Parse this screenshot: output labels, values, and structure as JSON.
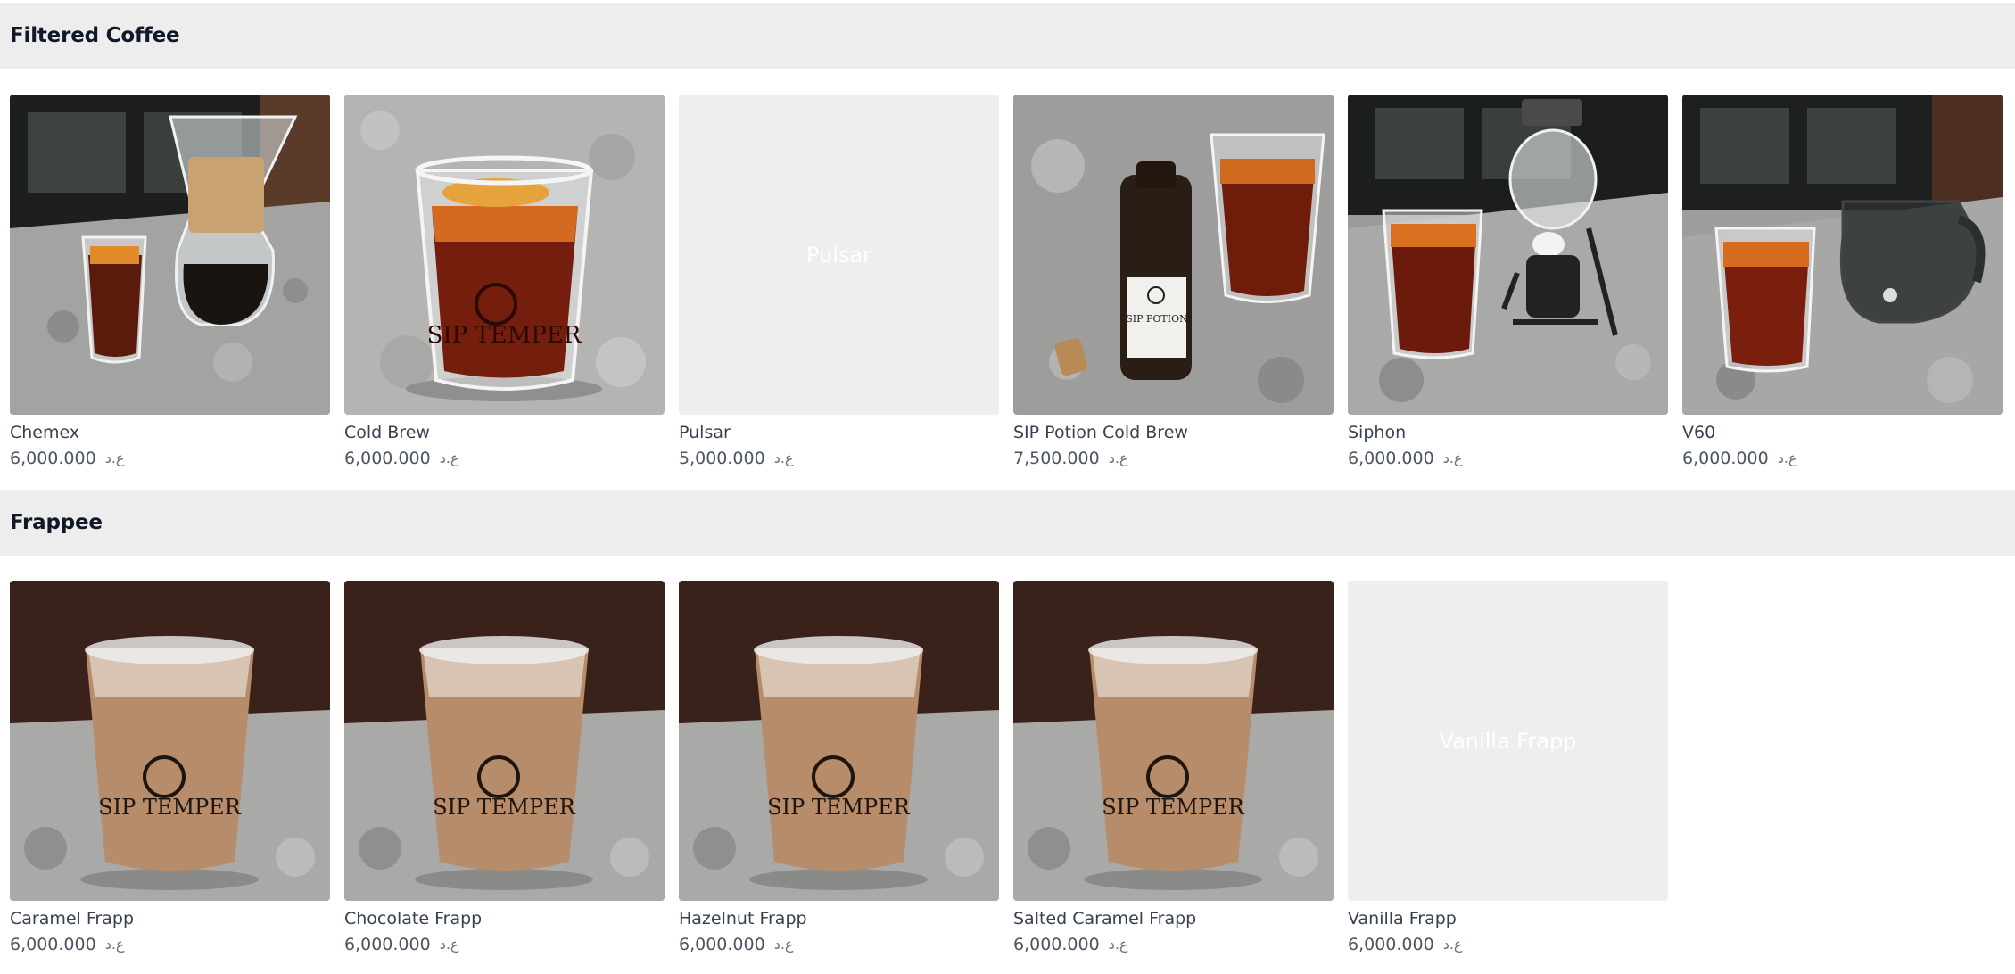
{
  "sections": [
    {
      "title": "Filtered Coffee",
      "items": [
        {
          "name": "Chemex",
          "price": "6,000.000",
          "currency": "ع.د",
          "image": "chemex-photo"
        },
        {
          "name": "Cold Brew",
          "price": "6,000.000",
          "currency": "ع.د",
          "image": "cold-brew-photo"
        },
        {
          "name": "Pulsar",
          "price": "5,000.000",
          "currency": "ع.د",
          "placeholder": "Pulsar"
        },
        {
          "name": "SIP Potion Cold Brew",
          "price": "7,500.000",
          "currency": "ع.د",
          "image": "sip-potion-photo"
        },
        {
          "name": "Siphon",
          "price": "6,000.000",
          "currency": "ع.د",
          "image": "siphon-photo"
        },
        {
          "name": "V60",
          "price": "6,000.000",
          "currency": "ع.د",
          "image": "v60-photo"
        }
      ]
    },
    {
      "title": "Frappee",
      "items": [
        {
          "name": "Caramel Frapp",
          "price": "6,000.000",
          "currency": "ع.د",
          "image": "frapp-photo"
        },
        {
          "name": "Chocolate Frapp",
          "price": "6,000.000",
          "currency": "ع.د",
          "image": "frapp-photo"
        },
        {
          "name": "Hazelnut Frapp",
          "price": "6,000.000",
          "currency": "ع.د",
          "image": "frapp-photo"
        },
        {
          "name": "Salted Caramel Frapp",
          "price": "6,000.000",
          "currency": "ع.د",
          "image": "frapp-photo"
        },
        {
          "name": "Vanilla Frapp",
          "price": "6,000.000",
          "currency": "ع.د",
          "placeholder": "Vanilla Frapp"
        }
      ]
    }
  ],
  "colors": {
    "section_bg": "#ededed",
    "placeholder_bg": "#eeeeee",
    "text": "#374151"
  }
}
